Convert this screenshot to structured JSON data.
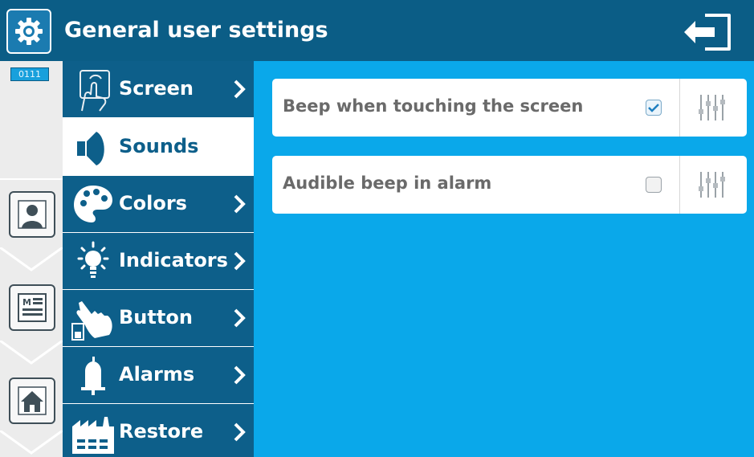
{
  "header": {
    "title": "General user settings",
    "icon": "gear-icon",
    "exit_icon": "exit-icon"
  },
  "rail": {
    "code": "0111",
    "buttons": [
      {
        "icon": "user-icon"
      },
      {
        "icon": "menu-list-icon"
      },
      {
        "icon": "home-icon"
      }
    ]
  },
  "menu": {
    "items": [
      {
        "label": "Screen",
        "icon": "touch-screen-icon",
        "active": false
      },
      {
        "label": "Sounds",
        "icon": "speaker-icon",
        "active": true
      },
      {
        "label": "Colors",
        "icon": "palette-icon",
        "active": false
      },
      {
        "label": "Indicators",
        "icon": "light-bulb-icon",
        "active": false
      },
      {
        "label": "Button",
        "icon": "hand-press-icon",
        "active": false
      },
      {
        "label": "Alarms",
        "icon": "bell-icon",
        "active": false
      },
      {
        "label": "Restore",
        "icon": "factory-icon",
        "active": false
      }
    ]
  },
  "settings": [
    {
      "label": "Beep when touching the screen",
      "checked": true
    },
    {
      "label": "Audible beep in alarm",
      "checked": false
    }
  ],
  "colors": {
    "header": "#0b5d86",
    "menu": "#0d5f8a",
    "content": "#0aa8ea",
    "rail": "#ececec",
    "accent": "#18a0dc"
  }
}
